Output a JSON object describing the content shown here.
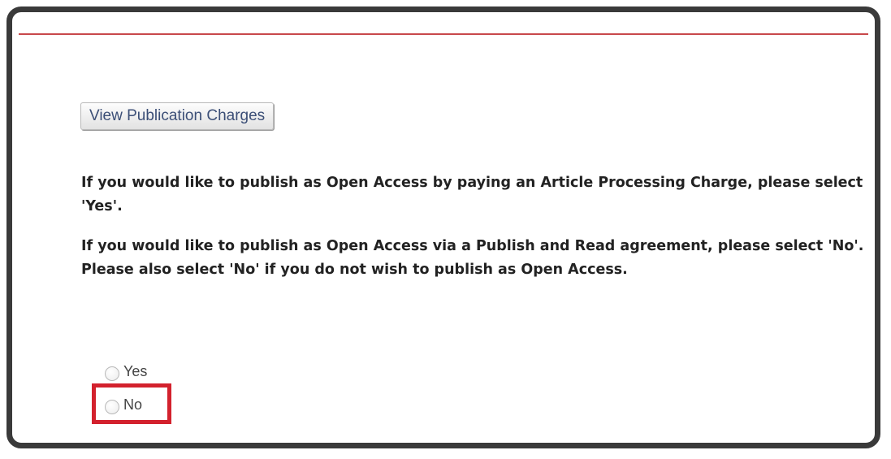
{
  "charges_button_label": "View Publication Charges",
  "paragraphs": {
    "apc_text": "If you would like to publish as Open Access by paying an Article Processing Charge, please select 'Yes'.",
    "agreement_text": "If you would like to publish as Open Access via a Publish and Read agreement, please select 'No'. Please also select 'No' if you do not wish to publish as Open Access."
  },
  "options": [
    {
      "label": "Yes",
      "selected": false
    },
    {
      "label": "No",
      "selected": false,
      "highlighted": true
    }
  ],
  "colors": {
    "accent_line": "#c8484b",
    "highlight_box": "#d3212d",
    "button_text": "#3c4f77"
  }
}
